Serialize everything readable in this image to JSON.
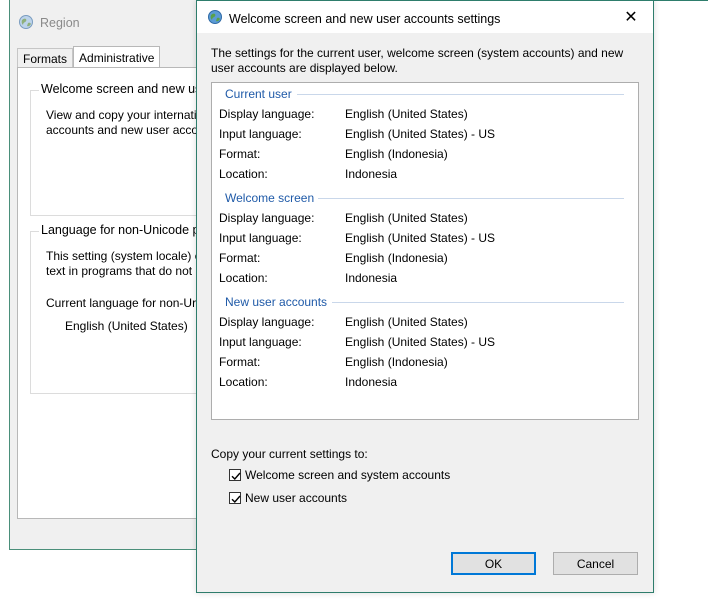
{
  "region": {
    "title": "Region",
    "tabs": [
      {
        "label": "Formats"
      },
      {
        "label": "Administrative"
      }
    ],
    "welcome_group": {
      "title": "Welcome screen and new user",
      "text_line1": "View and copy your internati",
      "text_line2": "accounts and new user acco"
    },
    "nonunicode_group": {
      "title": "Language for non-Unicode pr",
      "text_line1": "This setting (system locale) c",
      "text_line2": "text in programs that do not",
      "current_label": "Current language for non-Ur",
      "current_value": "English (United States)"
    }
  },
  "dialog": {
    "title": "Welcome screen and new user accounts settings",
    "close_glyph": "✕",
    "intro_line1": "The settings for the current user, welcome screen (system accounts) and new",
    "intro_line2": "user accounts are displayed below.",
    "sections": [
      {
        "title": "Current user",
        "rows": [
          {
            "label": "Display language:",
            "value": "English (United States)"
          },
          {
            "label": "Input language:",
            "value": "English (United States) - US"
          },
          {
            "label": "Format:",
            "value": "English (Indonesia)"
          },
          {
            "label": "Location:",
            "value": "Indonesia"
          }
        ]
      },
      {
        "title": "Welcome screen",
        "rows": [
          {
            "label": "Display language:",
            "value": "English (United States)"
          },
          {
            "label": "Input language:",
            "value": "English (United States) - US"
          },
          {
            "label": "Format:",
            "value": "English (Indonesia)"
          },
          {
            "label": "Location:",
            "value": "Indonesia"
          }
        ]
      },
      {
        "title": "New user accounts",
        "rows": [
          {
            "label": "Display language:",
            "value": "English (United States)"
          },
          {
            "label": "Input language:",
            "value": "English (United States) - US"
          },
          {
            "label": "Format:",
            "value": "English (Indonesia)"
          },
          {
            "label": "Location:",
            "value": "Indonesia"
          }
        ]
      }
    ],
    "copy_label": "Copy your current settings to:",
    "checkboxes": [
      {
        "label": "Welcome screen and system accounts",
        "checked": true
      },
      {
        "label": "New user accounts",
        "checked": true
      }
    ],
    "ok_label": "OK",
    "cancel_label": "Cancel"
  },
  "colors": {
    "accent": "#2e7d6c",
    "section_heading": "#1f5aa8",
    "default_button_border": "#0078d7"
  }
}
